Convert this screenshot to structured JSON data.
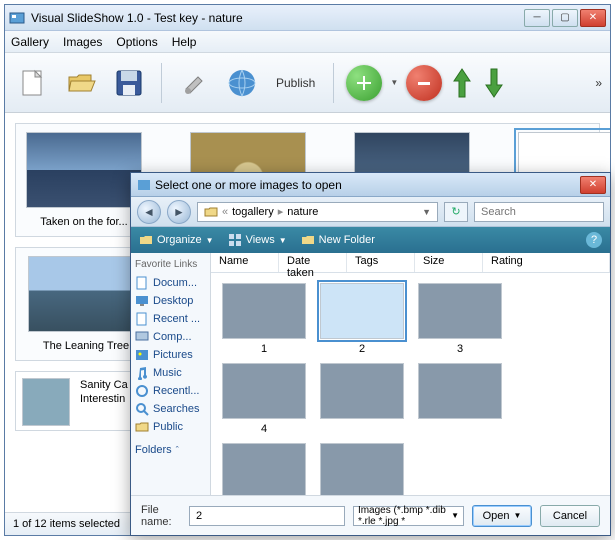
{
  "main": {
    "title": "Visual SlideShow 1.0 - Test key - nature",
    "menu": {
      "gallery": "Gallery",
      "images": "Images",
      "options": "Options",
      "help": "Help"
    },
    "toolbar": {
      "publish": "Publish"
    },
    "thumbs": [
      {
        "caption": "Taken on the for..."
      },
      {
        "caption": ""
      },
      {
        "caption": ""
      },
      {
        "caption": ""
      }
    ],
    "row2": {
      "caption": "The Leaning Tree"
    },
    "desc": {
      "line1": "Sanity Ca",
      "line2": "Interestin"
    },
    "status": "1 of 12 items selected"
  },
  "dialog": {
    "title": "Select one or more images to open",
    "crumb": {
      "p1": "togallery",
      "p2": "nature"
    },
    "search_placeholder": "Search",
    "toolbar": {
      "organize": "Organize",
      "views": "Views",
      "newfolder": "New Folder"
    },
    "sidebar": {
      "favorites": "Favorite Links",
      "items": {
        "docum": "Docum...",
        "desktop": "Desktop",
        "recent": "Recent ...",
        "comp": "Comp...",
        "pictures": "Pictures",
        "music": "Music",
        "recentl": "Recentl...",
        "searches": "Searches",
        "public": "Public"
      },
      "folders": "Folders"
    },
    "columns": {
      "name": "Name",
      "date": "Date taken",
      "tags": "Tags",
      "size": "Size",
      "rating": "Rating"
    },
    "files": [
      {
        "id": "1"
      },
      {
        "id": "2"
      },
      {
        "id": "3"
      },
      {
        "id": "4"
      },
      {
        "id": ""
      },
      {
        "id": ""
      },
      {
        "id": ""
      },
      {
        "id": ""
      }
    ],
    "selected_index": 1,
    "footer": {
      "filename_label": "File name:",
      "filename_value": "2",
      "filter": "Images (*.bmp *.dib *.rle *.jpg *",
      "open": "Open",
      "cancel": "Cancel"
    }
  }
}
